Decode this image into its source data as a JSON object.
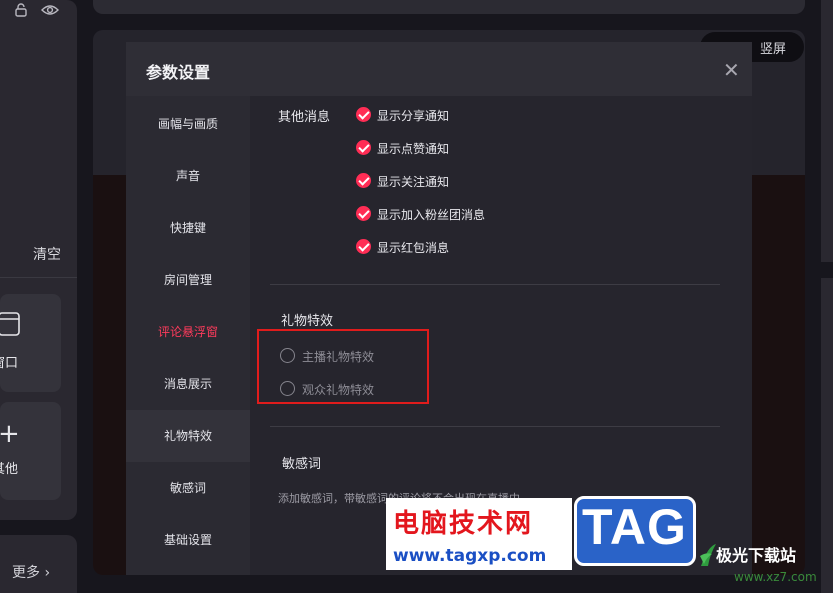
{
  "left_panel": {
    "clear_label": "清空",
    "tiles": [
      {
        "label": "窗口",
        "icon": "window-icon"
      },
      {
        "label": "其他",
        "icon": "plus-icon"
      }
    ],
    "more_label": "更多"
  },
  "orientation": {
    "label": "竖屏"
  },
  "dialog": {
    "title": "参数设置",
    "nav": [
      {
        "label": "画幅与画质"
      },
      {
        "label": "声音"
      },
      {
        "label": "快捷键"
      },
      {
        "label": "房间管理"
      },
      {
        "label": "评论悬浮窗"
      },
      {
        "label": "消息展示"
      },
      {
        "label": "礼物特效"
      },
      {
        "label": "敏感词"
      },
      {
        "label": "基础设置"
      }
    ],
    "other_messages": {
      "label": "其他消息",
      "options": [
        {
          "label": "显示分享通知",
          "checked": true
        },
        {
          "label": "显示点赞通知",
          "checked": true
        },
        {
          "label": "显示关注通知",
          "checked": true
        },
        {
          "label": "显示加入粉丝团消息",
          "checked": true
        },
        {
          "label": "显示红包消息",
          "checked": true
        }
      ]
    },
    "gift_effects": {
      "label": "礼物特效",
      "options": [
        {
          "label": "主播礼物特效",
          "checked": false
        },
        {
          "label": "观众礼物特效",
          "checked": false
        }
      ]
    },
    "sensitive_words": {
      "label": "敏感词",
      "description": "添加敏感词，带敏感词的评论将不会出现在直播中"
    }
  },
  "watermark": {
    "title": "电脑技术网",
    "url": "www.tagxp.com",
    "tag": "TAG",
    "site": "极光下载站",
    "site_url": "www.xz7.com"
  },
  "colors": {
    "accent": "#ff2d55",
    "highlight_box": "#e01c1c"
  }
}
